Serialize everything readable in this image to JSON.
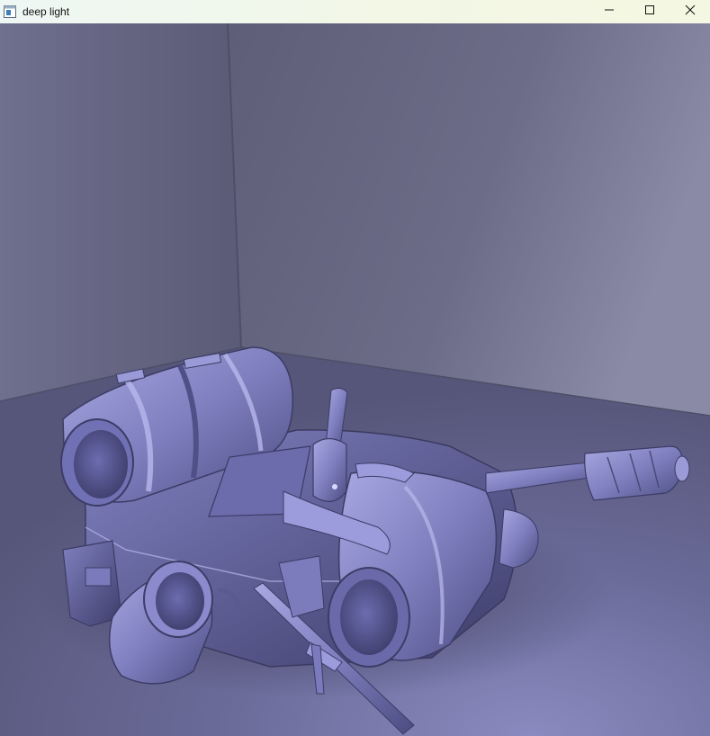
{
  "window": {
    "title": "deep light",
    "icons": {
      "app": "app-window-icon",
      "minimize": "minimize-icon",
      "maximize": "maximize-icon",
      "close": "close-icon"
    }
  },
  "scene": {
    "description_colors": {
      "wall": "#6b6b86",
      "floor": "#7a7aa6",
      "model": "#8a8ac8",
      "highlight": "#c8c8f0",
      "shadow": "#3c3c5e"
    }
  }
}
